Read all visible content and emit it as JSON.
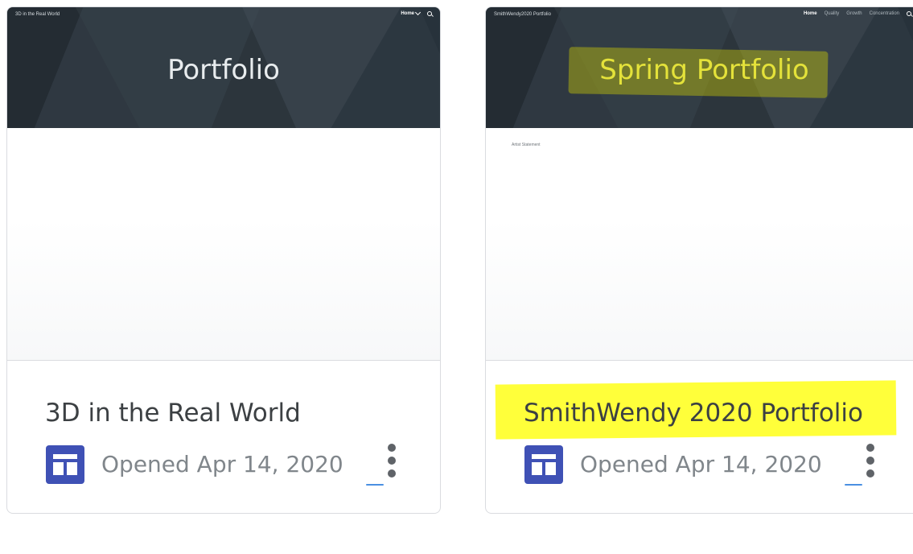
{
  "cards": [
    {
      "site_name": "3D in the Real World",
      "nav": {
        "active": "Home"
      },
      "banner_heading": "Portfolio",
      "title": "3D in the Real World",
      "opened": "Opened Apr 14, 2020",
      "icon": "google-sites-icon",
      "more_icon": "more-vert-icon"
    },
    {
      "site_name": "SmithWendy2020 Portfolio",
      "nav": {
        "active": "Home",
        "items": [
          "Quality",
          "Growth",
          "Concentration"
        ]
      },
      "banner_heading": "Spring Portfolio",
      "body_text": "Artist Statement",
      "title": "SmithWendy 2020 Portfolio",
      "opened": "Opened Apr 14, 2020",
      "icon": "google-sites-icon",
      "more_icon": "more-vert-icon"
    }
  ],
  "colors": {
    "banner": "#2c353c",
    "sites_icon": "#3f51b5",
    "title_highlight": "#ffff3a",
    "heading_highlight": "#dddd00",
    "focus_line": "#4a90e2",
    "title_text": "#3c4043",
    "meta_text": "#80868b"
  }
}
